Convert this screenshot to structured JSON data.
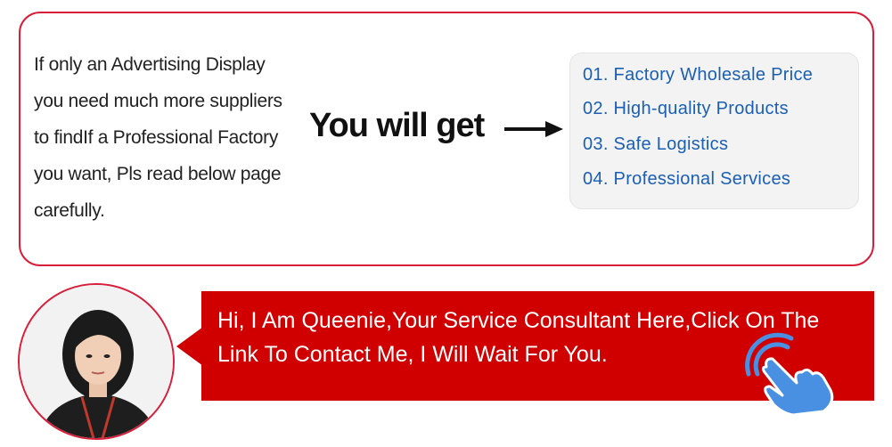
{
  "intro": {
    "lines": [
      "If only an Advertising Display",
      "you need much more suppliers",
      "to findIf a Professional Factory",
      "you want, Pls read below page",
      "carefully."
    ]
  },
  "cta": {
    "label": "You will get",
    "arrow_icon": "arrow-right-icon"
  },
  "benefits": [
    "01. Factory Wholesale Price",
    "02. High-quality Products",
    "03. Safe Logistics",
    "04. Professional Services"
  ],
  "consultant": {
    "avatar_icon": "consultant-avatar",
    "message_line1": "Hi, I Am Queenie,Your Service Consultant Here,Click On The",
    "message_line2": "Link To Contact Me, I Will Wait For You.",
    "hand_icon": "tap-hand-icon"
  },
  "colors": {
    "accent_red": "#d91e3c",
    "banner_red": "#d00000",
    "benefit_blue": "#1a5fb4",
    "hand_blue": "#4a90e2"
  }
}
